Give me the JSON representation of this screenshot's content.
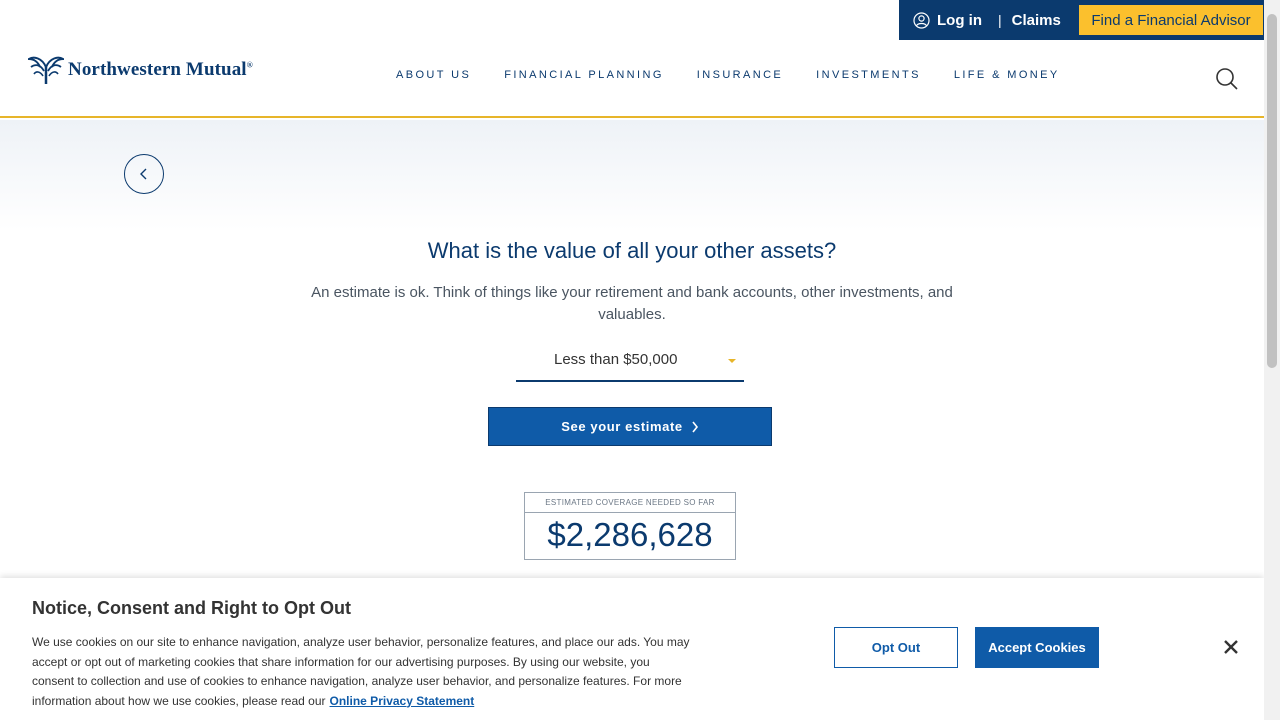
{
  "utility": {
    "login_label": "Log in",
    "divider": "|",
    "claims_label": "Claims",
    "find_advisor_label": "Find a Financial Advisor"
  },
  "header": {
    "logo_text": "Northwestern Mutual",
    "logo_reg": "®",
    "nav": [
      {
        "label": "ABOUT US"
      },
      {
        "label": "FINANCIAL PLANNING"
      },
      {
        "label": "INSURANCE"
      },
      {
        "label": "INVESTMENTS"
      },
      {
        "label": "LIFE & MONEY"
      }
    ]
  },
  "main": {
    "question": "What is the value of all your other assets?",
    "subtext": "An estimate is ok. Think of things like your retirement and bank accounts, other investments, and valuables.",
    "select_value": "Less than $50,000",
    "estimate_button": "See your estimate",
    "coverage_label": "ESTIMATED COVERAGE NEEDED SO FAR",
    "coverage_value": "$2,286,628"
  },
  "cookie": {
    "title": "Notice, Consent and Right to Opt Out",
    "text": "We use cookies on our site to enhance navigation, analyze user behavior, personalize features, and place our ads. You may accept or opt out of marketing cookies that share information for our advertising purposes. By using our website, you consent to collection and use of cookies to enhance navigation, analyze user behavior, and personalize features. For more information about how we use cookies, please read our",
    "link_label": "Online Privacy Statement",
    "opt_out_label": "Opt Out",
    "accept_label": "Accept Cookies"
  },
  "colors": {
    "brand_navy": "#0b3a6e",
    "brand_blue": "#0f5ba8",
    "accent_gold": "#fbc02d"
  },
  "icons": {
    "user": "user-circle-icon",
    "search": "search-icon",
    "back": "chevron-left-icon",
    "button_arrow": "chevron-right-icon",
    "close": "close-icon"
  }
}
